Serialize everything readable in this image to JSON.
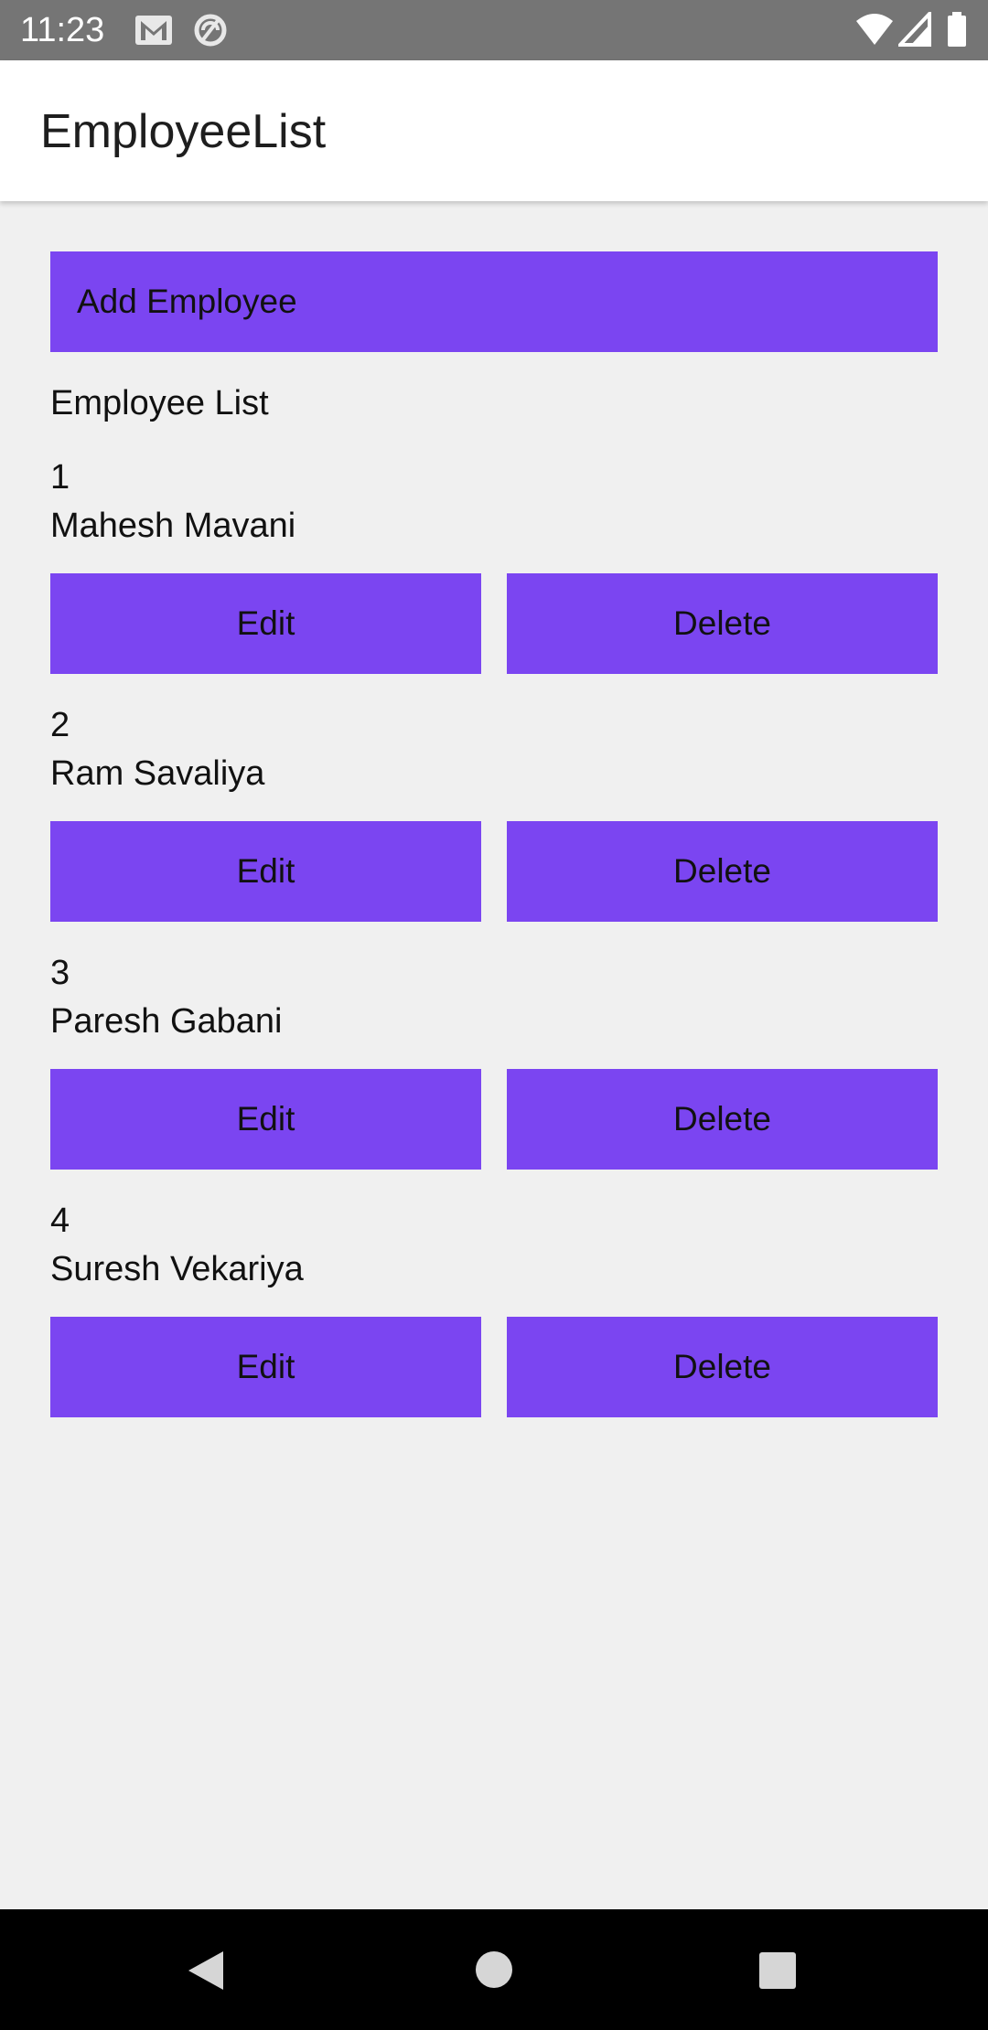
{
  "status_bar": {
    "time": "11:23",
    "icons_left": [
      "gmail-icon",
      "sync-icon"
    ],
    "icons_right": [
      "wifi-icon",
      "signal-icon",
      "battery-icon"
    ]
  },
  "app_bar": {
    "title": "EmployeeList"
  },
  "main": {
    "add_button_label": "Add Employee",
    "section_label": "Employee List",
    "employees": [
      {
        "id": "1",
        "name": "Mahesh Mavani",
        "edit_label": "Edit",
        "delete_label": "Delete"
      },
      {
        "id": "2",
        "name": "Ram Savaliya",
        "edit_label": "Edit",
        "delete_label": "Delete"
      },
      {
        "id": "3",
        "name": "Paresh Gabani",
        "edit_label": "Edit",
        "delete_label": "Delete"
      },
      {
        "id": "4",
        "name": "Suresh Vekariya",
        "edit_label": "Edit",
        "delete_label": "Delete"
      }
    ]
  },
  "nav_bar": {
    "icons": [
      "back-icon",
      "home-icon",
      "recents-icon"
    ]
  },
  "colors": {
    "button": "#7b45f1",
    "status_bar": "#757575",
    "background": "#f0f0f0",
    "app_bar": "#ffffff",
    "nav_bar": "#000000"
  }
}
